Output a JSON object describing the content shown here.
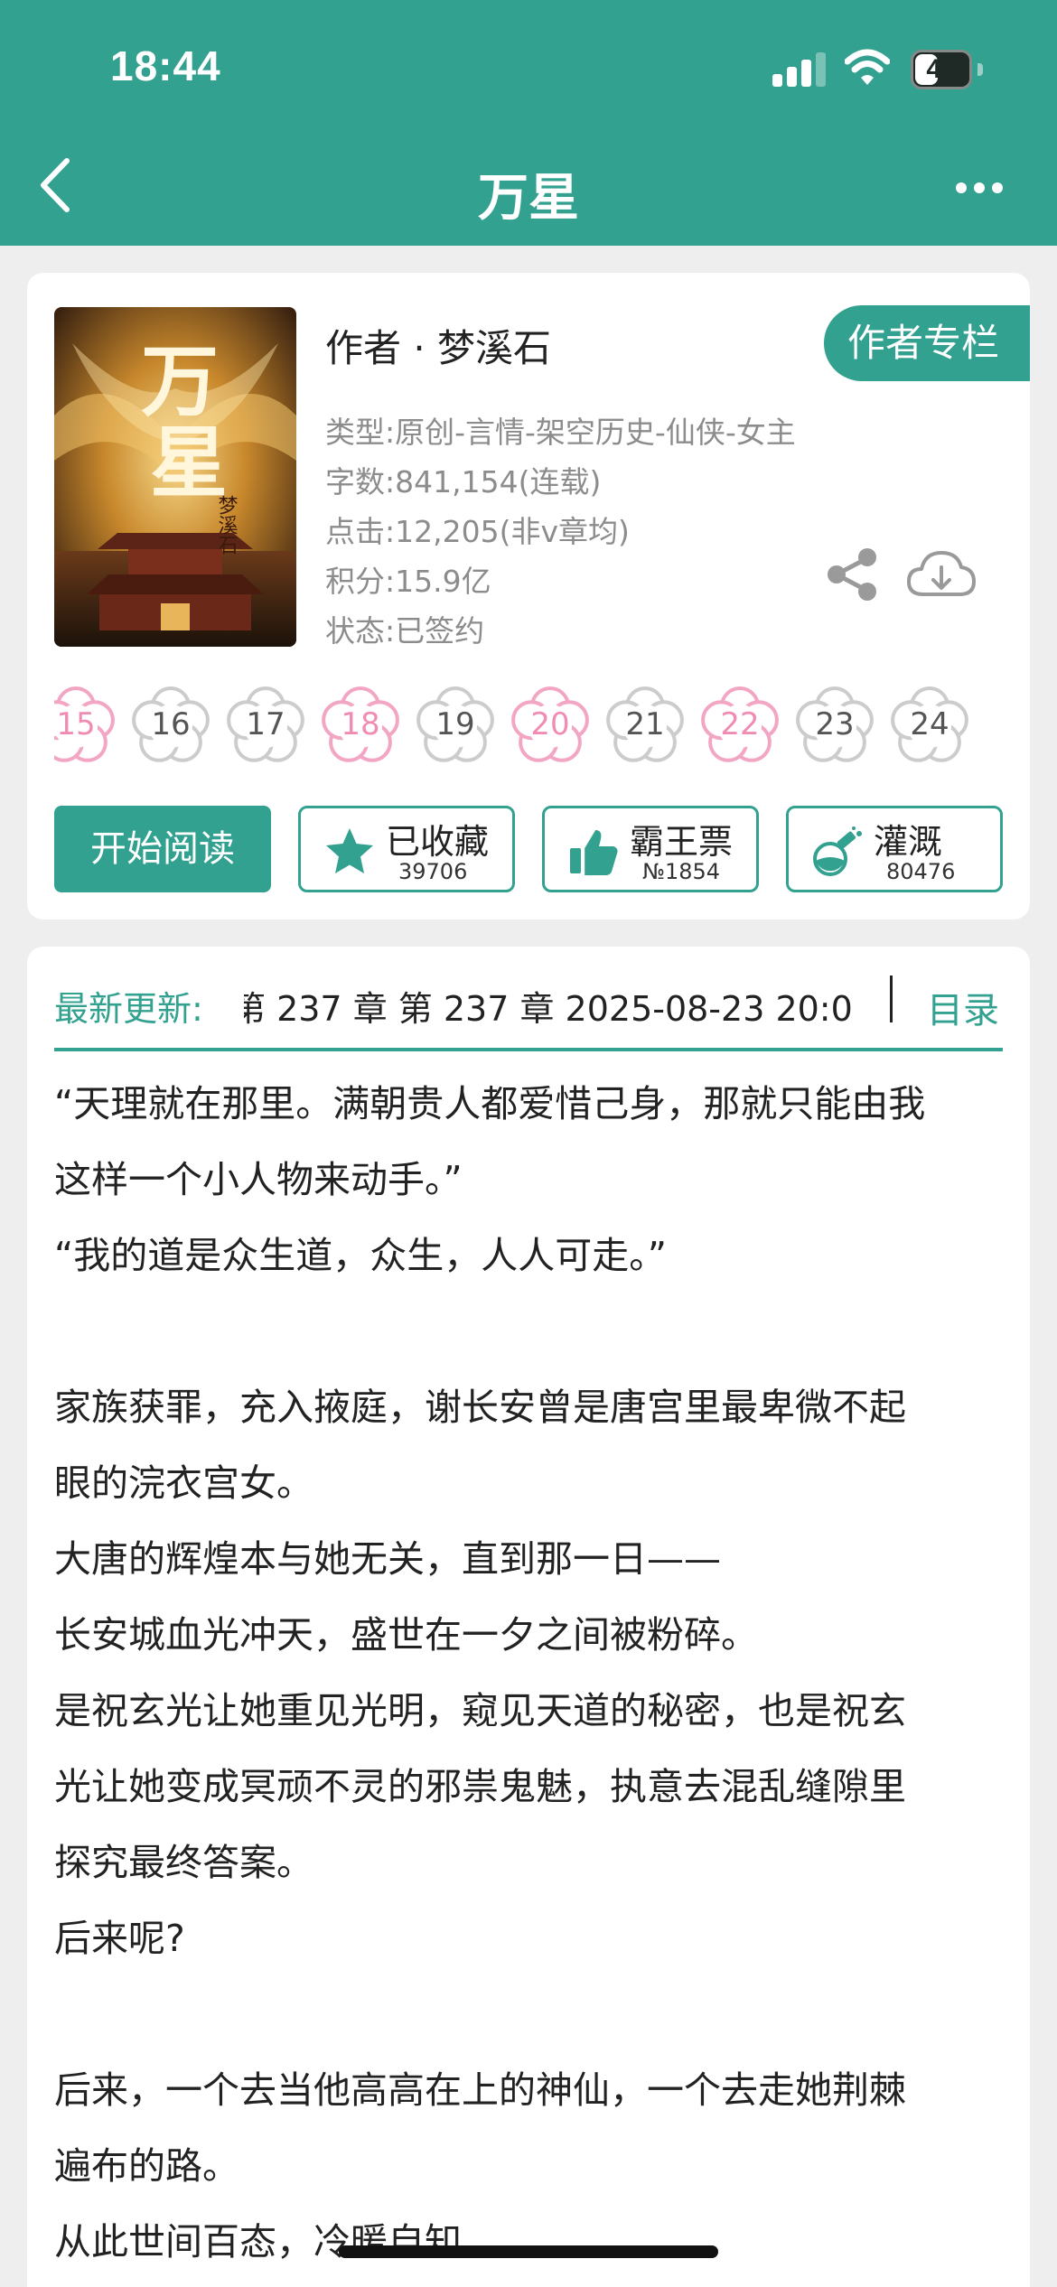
{
  "status_bar": {
    "time": "18:44",
    "battery": "40",
    "battery_level": 0.4
  },
  "nav": {
    "title": "万星"
  },
  "book": {
    "author": "作者 · 梦溪石",
    "author_column": "作者专栏",
    "cover_title": "万星",
    "cover_signature": "梦溪石",
    "meta": {
      "genre": "类型:原创-言情-架空历史-仙侠-女主",
      "words": "字数:841,154(连载)",
      "clicks": "点击:12,205(非v章均)",
      "score": "积分:15.9亿",
      "status": "状态:已签约"
    }
  },
  "ratings": [
    {
      "num": "15",
      "highlight": true
    },
    {
      "num": "16",
      "highlight": false
    },
    {
      "num": "17",
      "highlight": false
    },
    {
      "num": "18",
      "highlight": true
    },
    {
      "num": "19",
      "highlight": false
    },
    {
      "num": "20",
      "highlight": true
    },
    {
      "num": "21",
      "highlight": false
    },
    {
      "num": "22",
      "highlight": true
    },
    {
      "num": "23",
      "highlight": false
    },
    {
      "num": "24",
      "highlight": false
    }
  ],
  "actions": {
    "start_reading": "开始阅读",
    "collect": {
      "label": "已收藏",
      "count": "39706",
      "icon": "star-icon"
    },
    "vote": {
      "label": "霸王票",
      "count": "№1854",
      "icon": "thumbs-up-icon"
    },
    "water": {
      "label": "灌溉",
      "count": "80476",
      "icon": "watering-bottle-icon"
    }
  },
  "update": {
    "label": "最新更新:",
    "text": "第 237 章 第 237 章 2025-08-23 20:0",
    "toc": "目录"
  },
  "description": [
    "“天理就在那里。满朝贵人都爱惜己身，那就只能由我",
    "这样一个小人物来动手。”",
    "“我的道是众生道，众生，人人可走。”",
    "",
    "家族获罪，充入掖庭，谢长安曾是唐宫里最卑微不起",
    "眼的浣衣宫女。",
    "大唐的辉煌本与她无关，直到那一日——",
    "长安城血光冲天，盛世在一夕之间被粉碎。",
    "是祝玄光让她重见光明，窥见天道的秘密，也是祝玄",
    "光让她变成冥顽不灵的邪祟鬼魅，执意去混乱缝隙里",
    "探究最终答案。",
    "后来呢?",
    "",
    "后来，一个去当他高高在上的神仙，一个去走她荆棘",
    "遍布的路。",
    "从此世间百态，冷暖自知。"
  ],
  "colors": {
    "accent": "#33a190",
    "rating_pink": "#f2a6c4",
    "rating_gray": "#cccccc"
  }
}
